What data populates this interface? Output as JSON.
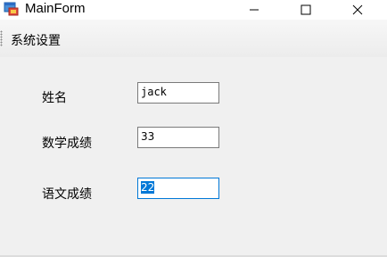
{
  "window": {
    "title": "MainForm",
    "icon": "winforms-app-icon",
    "controls": [
      "minimize-icon",
      "maximize-icon",
      "close-icon"
    ]
  },
  "menu": {
    "items": [
      {
        "label": "系统设置"
      }
    ]
  },
  "form": {
    "fields": [
      {
        "label": "姓名",
        "value": "jack"
      },
      {
        "label": "数学成绩",
        "value": "33"
      },
      {
        "label": "语文成绩",
        "value": "22",
        "selected": true
      }
    ]
  },
  "colors": {
    "selection": "#0078d7",
    "background": "#f0f0f0"
  }
}
